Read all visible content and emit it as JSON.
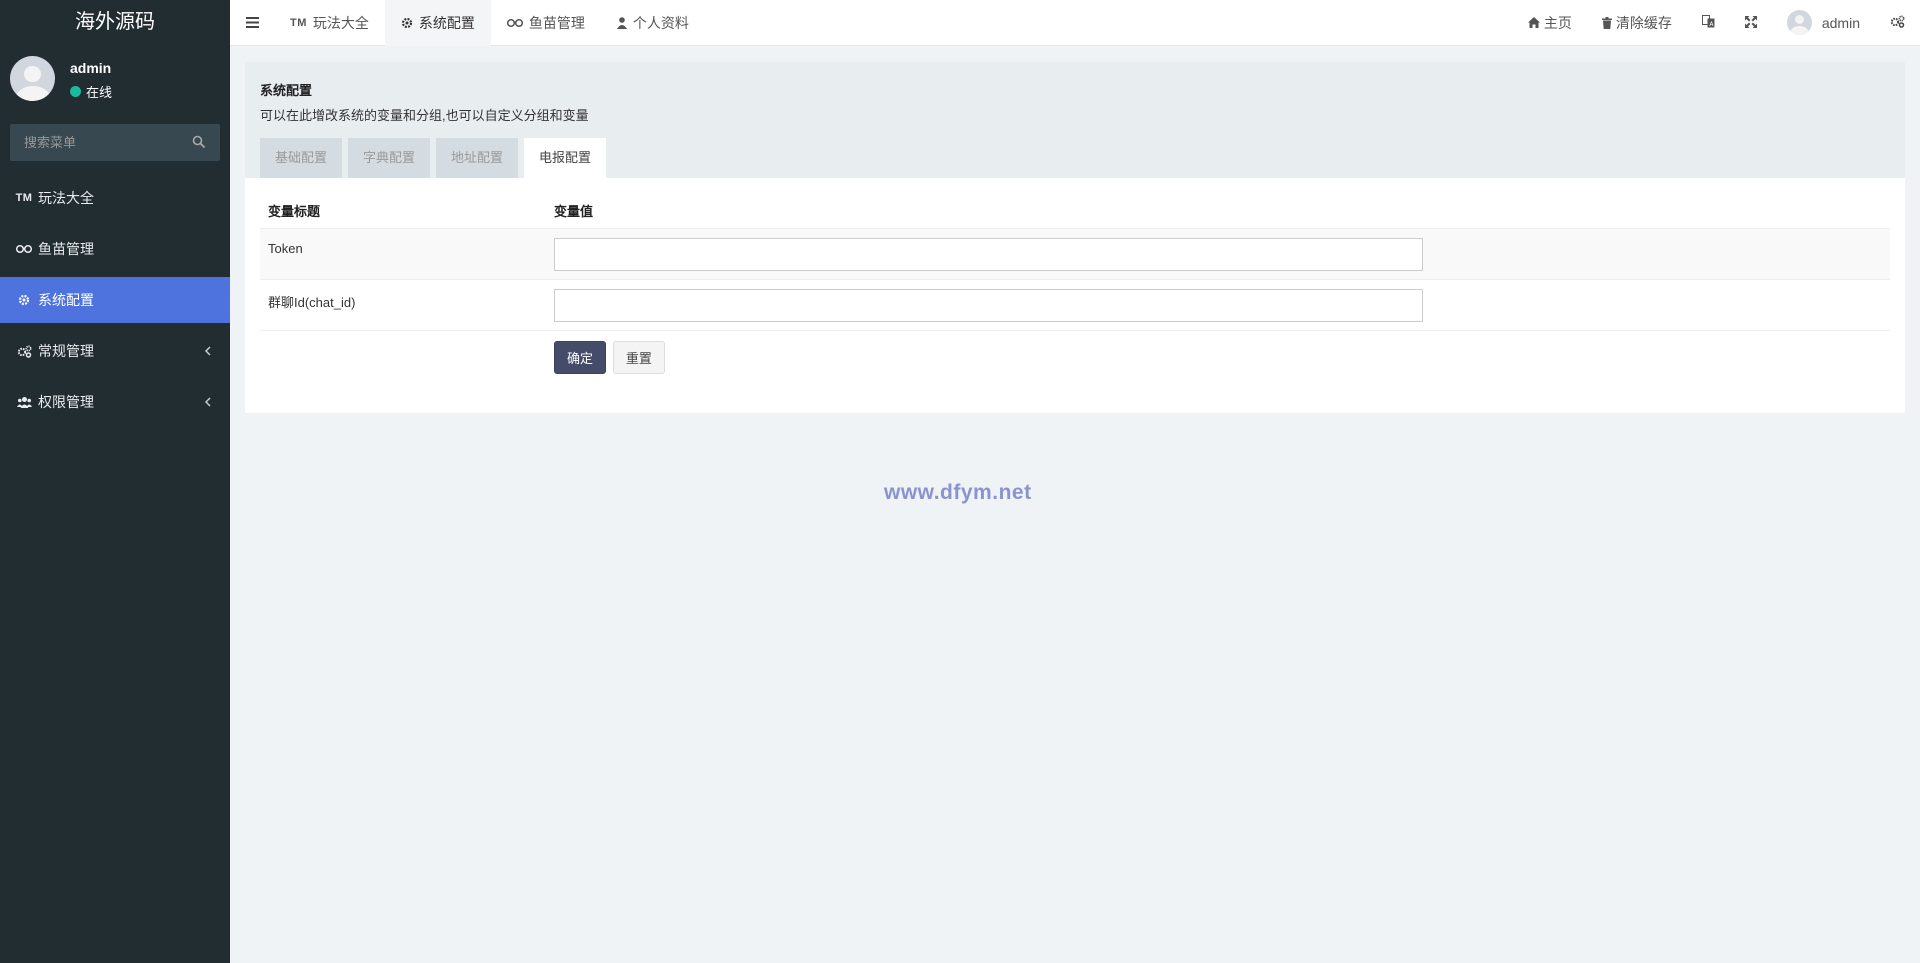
{
  "sidebar": {
    "logo": "海外源码",
    "user": {
      "name": "admin",
      "status": "在线"
    },
    "search_placeholder": "搜索菜单",
    "items": [
      {
        "label": "玩法大全",
        "icon": "tm-icon",
        "active": false
      },
      {
        "label": "鱼苗管理",
        "icon": "binoculars-icon",
        "active": false
      },
      {
        "label": "系统配置",
        "icon": "gear-icon",
        "active": true
      },
      {
        "label": "常规管理",
        "icon": "cogs-icon",
        "active": false,
        "has_children": true
      },
      {
        "label": "权限管理",
        "icon": "group-icon",
        "active": false,
        "has_children": true
      }
    ]
  },
  "topbar": {
    "tabs": [
      {
        "label": "玩法大全",
        "icon": "tm-icon",
        "icon_text": "TM"
      },
      {
        "label": "系统配置",
        "icon": "gear-icon",
        "active": true
      },
      {
        "label": "鱼苗管理",
        "icon": "binoculars-icon"
      },
      {
        "label": "个人资料",
        "icon": "user-icon"
      }
    ],
    "right": {
      "home": "主页",
      "clear_cache": "清除缓存",
      "user": "admin"
    }
  },
  "panel": {
    "title": "系统配置",
    "description": "可以在此增改系统的变量和分组,也可以自定义分组和变量",
    "tabs": [
      "基础配置",
      "字典配置",
      "地址配置",
      "电报配置"
    ],
    "active_tab": "电报配置",
    "table": {
      "col_title": "变量标题",
      "col_value": "变量值",
      "rows": [
        {
          "label": "Token",
          "value": ""
        },
        {
          "label": "群聊Id(chat_id)",
          "value": ""
        }
      ]
    },
    "submit_label": "确定",
    "reset_label": "重置"
  },
  "watermark": "www.dfym.net"
}
